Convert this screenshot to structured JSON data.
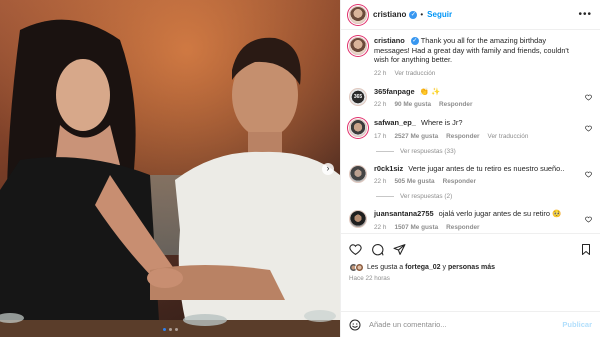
{
  "header": {
    "username": "cristiano",
    "separator": "•",
    "follow_label": "Seguir",
    "more_icon": "more-dots-icon"
  },
  "caption": {
    "username": "cristiano",
    "text": "Thank you all for the amazing birthday messages! Had a great day with family and friends, couldn't wish for anything better.",
    "time": "22 h",
    "translate": "Ver traducción"
  },
  "comments": [
    {
      "username": "365fanpage",
      "text": "👏 ✨",
      "time": "22 h",
      "likes": "90 Me gusta",
      "reply": "Responder",
      "translate": ""
    },
    {
      "username": "safwan_ep_",
      "text": "Where is Jr?",
      "time": "17 h",
      "likes": "2527 Me gusta",
      "reply": "Responder",
      "translate": "Ver traducción",
      "replies_label": "Ver respuestas (33)"
    },
    {
      "username": "r0ck1siz",
      "text": "Verte jugar antes de tu retiro es nuestro sueño..",
      "time": "22 h",
      "likes": "505 Me gusta",
      "reply": "Responder",
      "translate": "",
      "replies_label": "Ver respuestas (2)"
    },
    {
      "username": "juansantana2755",
      "text": "ojalá verlo jugar antes de su retiro 🥺",
      "time": "22 h",
      "likes": "1507 Me gusta",
      "reply": "Responder",
      "translate": ""
    }
  ],
  "actions": {
    "likes_prefix": "Les gusta a",
    "likes_user": "fortega_02",
    "likes_joiner": "y",
    "likes_others": "personas más",
    "posted_time": "Hace 22 horas"
  },
  "composer": {
    "placeholder": "Añade un comentario...",
    "publish_label": "Publicar"
  },
  "colors": {
    "accent": "#0095f6",
    "verified": "#3897f0",
    "muted": "#8e8e8e",
    "heart_outline": "#262626"
  }
}
